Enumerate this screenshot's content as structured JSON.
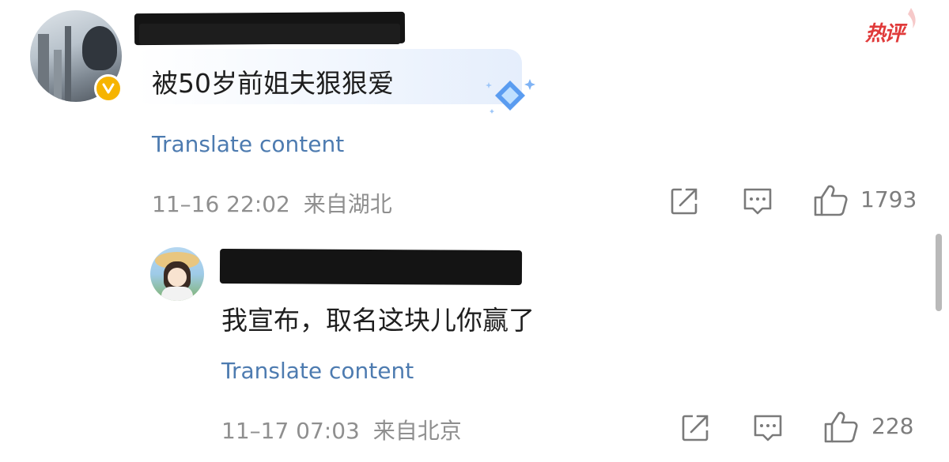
{
  "badge": {
    "hot_label": "热评",
    "color": "#e03a3a"
  },
  "comments": [
    {
      "author": "[redacted]",
      "verified": true,
      "text": "被50岁前姐夫狠狠爱",
      "translate_label": "Translate content",
      "timestamp": "11–16 22:02",
      "location": "来自湖北",
      "likes": "1793",
      "icons": [
        "share-icon",
        "reply-icon",
        "like-icon"
      ]
    }
  ],
  "replies": [
    {
      "author": "[redacted]",
      "text": "我宣布，取名这块儿你赢了",
      "translate_label": "Translate content",
      "timestamp": "11–17 07:03",
      "location": "来自北京",
      "likes": "228",
      "icons": [
        "share-icon",
        "reply-icon",
        "like-icon"
      ]
    }
  ],
  "colors": {
    "link": "#4d7bb0",
    "meta": "#8f8f8f",
    "verified": "#f6b400"
  }
}
